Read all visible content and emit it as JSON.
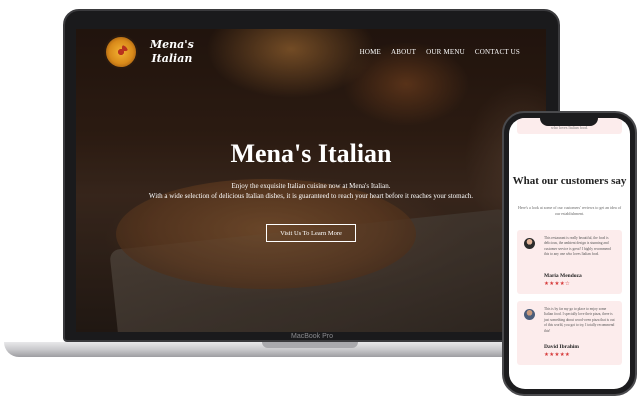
{
  "laptop": {
    "model_label": "MacBook Pro"
  },
  "site": {
    "logo_icon": "pizza-icon",
    "brand_line1": "Mena's",
    "brand_line2": "Italian",
    "nav": [
      "HOME",
      "ABOUT",
      "OUR MENU",
      "CONTACT US"
    ],
    "hero": {
      "title": "Mena's Italian",
      "line1": "Enjoy the exquisite Italian cuisine now at Mena's Italian.",
      "line2": "With a wide selection of delicious Italian dishes, it is guaranteed to reach your heart before it reaches your stomach.",
      "cta": "Visit Us To Learn More"
    }
  },
  "phone": {
    "top_card_text": "who loves Italian food.",
    "reviews": {
      "title": "What our customers say",
      "subtitle": "Here's a look at some of our customers' reviews to get an idea of our establishment.",
      "items": [
        {
          "text": "This restaurant is really beautiful, the food is delicious, the ambient design is stunning and customer service is great! I highly recommend this to any one who loves Italian food.",
          "name": "Maria Mendoza",
          "stars": "★★★★☆",
          "rating": 4
        },
        {
          "text": "This is by far my go to place to enjoy some Italian food. I specially love their pizza, there is just something about wood-oven pizza that is out of this world, you got to try, I totally recommend this!",
          "name": "David Ibrahim",
          "stars": "★★★★★",
          "rating": 5
        }
      ]
    }
  },
  "colors": {
    "accent_star": "#d63b3b",
    "card_bg": "#fcecec"
  }
}
